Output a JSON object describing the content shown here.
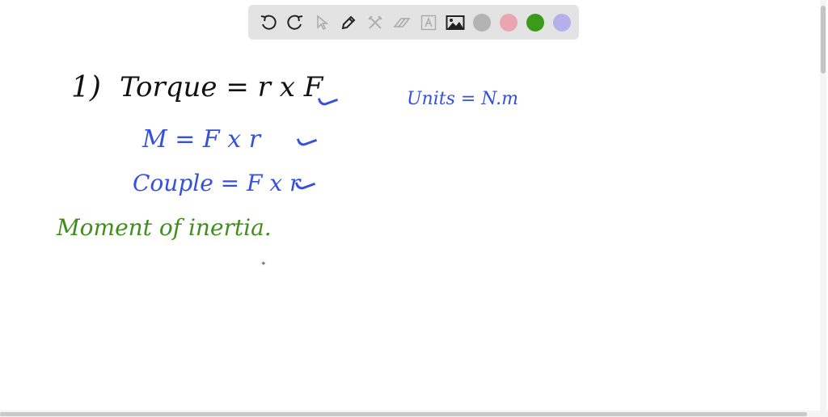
{
  "toolbar": {
    "tools": [
      "undo-icon",
      "redo-icon",
      "select-icon",
      "pen-icon",
      "tools-icon",
      "eraser-icon",
      "text-icon",
      "image-icon"
    ],
    "colors": [
      "#b3b3b3",
      "#e8a6b0",
      "#3b9a1a",
      "#b3b0ea"
    ]
  },
  "canvas": {
    "line1_number": "1)",
    "line1": "Torque = r x F",
    "units": "Units = N.m",
    "line2": "M = F x r",
    "line3": "Couple = F x r",
    "line4": "Moment of inertia.",
    "ink_colors": {
      "black": "#111111",
      "blue": "#3550e0",
      "green": "#3e8f1c"
    }
  }
}
